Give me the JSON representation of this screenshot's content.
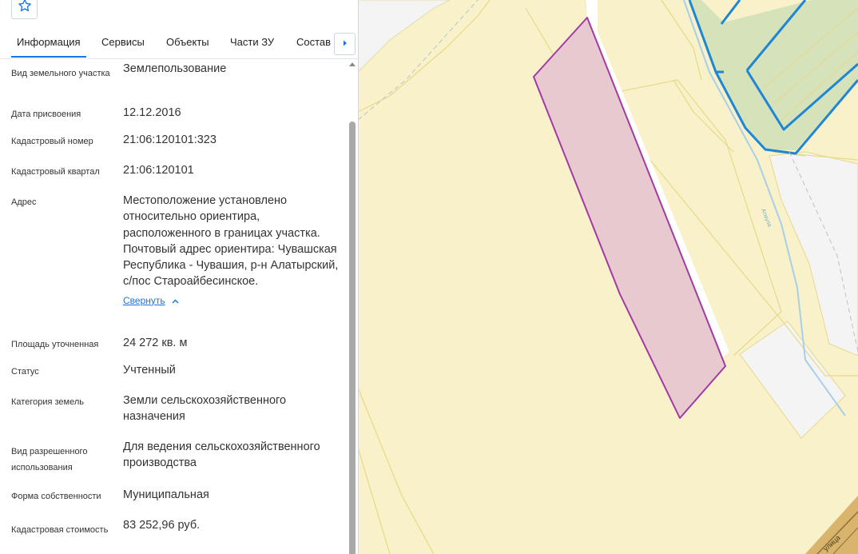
{
  "panel": {
    "tabs": [
      "Информация",
      "Сервисы",
      "Объекты",
      "Части ЗУ",
      "Состав"
    ],
    "rows": [
      {
        "label": "Вид земельного участка",
        "value": "Землепользование"
      },
      {
        "label": "Дата присвоения",
        "value": "12.12.2016"
      },
      {
        "label": "Кадастровый номер",
        "value": "21:06:120101:323"
      },
      {
        "label": "Кадастровый квартал",
        "value": "21:06:120101"
      },
      {
        "label": "Адрес",
        "value": "Местоположение установлено относительно ориентира, расположенного в границах участка. Почтовый адрес ориентира: Чувашская Республика - Чувашия, р-н Алатырский, с/пос Староайбесинское."
      },
      {
        "label": "Площадь уточненная",
        "value": "24 272 кв. м"
      },
      {
        "label": "Статус",
        "value": "Учтенный"
      },
      {
        "label": "Категория земель",
        "value": "Земли сельскохозяйственного назначения"
      },
      {
        "label": "Вид разрешенного использования",
        "value": "Для ведения сельскохозяйственного производства"
      },
      {
        "label": "Форма собственности",
        "value": "Муниципальная"
      },
      {
        "label": "Кадастровая стоимость",
        "value": "83 252,96 руб."
      }
    ],
    "collapse_label": "Свернуть"
  },
  "map": {
    "labels": {
      "stream": "Атмула",
      "street": "улица"
    },
    "colors": {
      "land": "#f8f1c9",
      "parcel_fill": "#e8c9cf",
      "parcel_stroke": "#a23aa6",
      "parcel_lines": "#e6d98a",
      "selected_border": "#1f86d6",
      "empty_area": "#f4f4f4",
      "stream": "#a9cfe8",
      "accent": "#1a73e8"
    }
  }
}
